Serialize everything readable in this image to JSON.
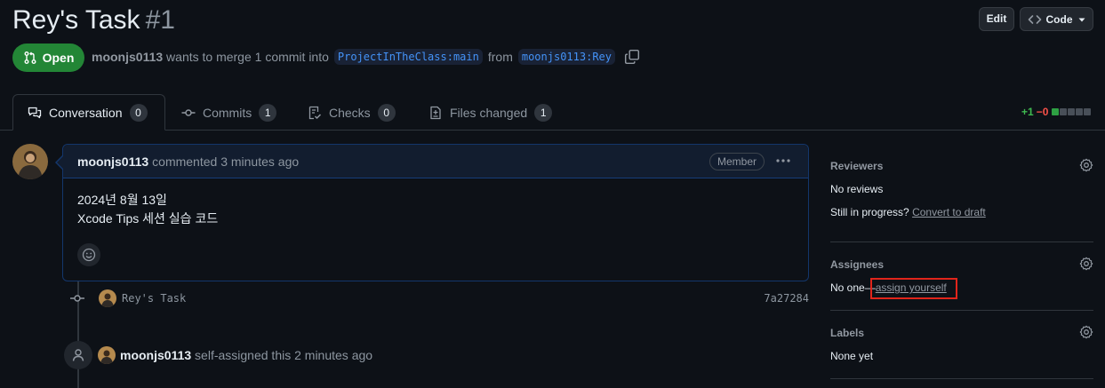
{
  "header": {
    "title": "Rey's Task",
    "number": "#1",
    "edit_label": "Edit",
    "code_label": "Code"
  },
  "state": {
    "label": "Open",
    "color": "#238636"
  },
  "merge": {
    "author": "moonjs0113",
    "text": "wants to merge 1 commit into",
    "base_branch": "ProjectInTheClass:main",
    "from_text": "from",
    "head_branch": "moonjs0113:Rey"
  },
  "tabs": [
    {
      "label": "Conversation",
      "count": "0",
      "icon": "comment-discussion-icon"
    },
    {
      "label": "Commits",
      "count": "1",
      "icon": "git-commit-icon"
    },
    {
      "label": "Checks",
      "count": "0",
      "icon": "checklist-icon"
    },
    {
      "label": "Files changed",
      "count": "1",
      "icon": "file-diff-icon"
    }
  ],
  "diffstat": {
    "additions": "+1",
    "deletions": "−0",
    "blocks": [
      "#2ea043",
      "#484f58",
      "#484f58",
      "#484f58",
      "#484f58"
    ]
  },
  "comment": {
    "author": "moonjs0113",
    "meta": "commented 3 minutes ago",
    "badge": "Member",
    "body_line1": "2024년 8월 13일",
    "body_line2": "Xcode Tips 세션 실습 코드"
  },
  "commit": {
    "message": "Rey's Task",
    "sha": "7a27284"
  },
  "event": {
    "author": "moonjs0113",
    "text": "self-assigned this 2 minutes ago"
  },
  "sidebar": {
    "reviewers": {
      "title": "Reviewers",
      "value": "No reviews",
      "progress_text": "Still in progress?",
      "progress_link": "Convert to draft"
    },
    "assignees": {
      "title": "Assignees",
      "value": "No one—",
      "link": "assign yourself"
    },
    "labels": {
      "title": "Labels",
      "value": "None yet"
    }
  },
  "colors": {
    "accent": "#4493f8",
    "highlight_box": "#e1251b"
  }
}
